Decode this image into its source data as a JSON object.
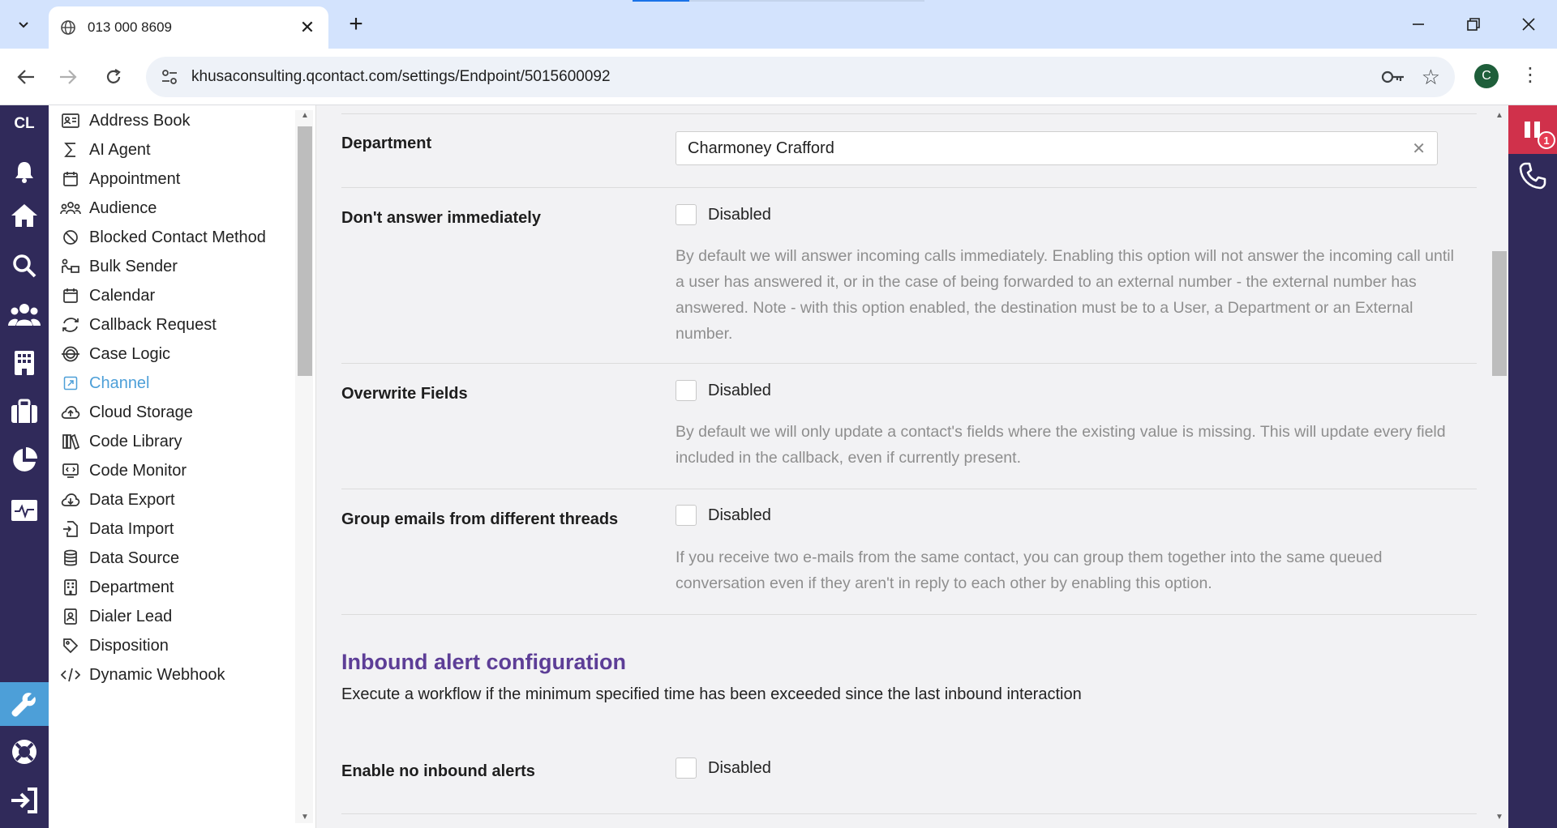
{
  "browser": {
    "tab_title": "013 000 8609",
    "url": "khusaconsulting.qcontact.com/settings/Endpoint/5015600092",
    "profile_initial": "C"
  },
  "rail": {
    "logo": "CL",
    "icons": [
      "bell-icon",
      "home-icon",
      "search-icon",
      "users-icon",
      "building-icon",
      "briefcase-icon",
      "pie-chart-icon",
      "monitor-icon",
      "wrench-icon",
      "lifebuoy-icon",
      "logout-icon"
    ]
  },
  "menu": {
    "items": [
      {
        "label": "Address Book",
        "icon": "address-book-icon"
      },
      {
        "label": "AI Agent",
        "icon": "sigma-icon"
      },
      {
        "label": "Appointment",
        "icon": "calendar-icon"
      },
      {
        "label": "Audience",
        "icon": "audience-icon"
      },
      {
        "label": "Blocked Contact Method",
        "icon": "blocked-icon"
      },
      {
        "label": "Bulk Sender",
        "icon": "bulk-sender-icon"
      },
      {
        "label": "Calendar",
        "icon": "calendar-icon"
      },
      {
        "label": "Callback Request",
        "icon": "callback-icon"
      },
      {
        "label": "Case Logic",
        "icon": "case-logic-icon"
      },
      {
        "label": "Channel",
        "icon": "channel-icon",
        "active": true
      },
      {
        "label": "Cloud Storage",
        "icon": "cloud-upload-icon"
      },
      {
        "label": "Code Library",
        "icon": "library-icon"
      },
      {
        "label": "Code Monitor",
        "icon": "code-monitor-icon"
      },
      {
        "label": "Data Export",
        "icon": "cloud-download-icon"
      },
      {
        "label": "Data Import",
        "icon": "file-import-icon"
      },
      {
        "label": "Data Source",
        "icon": "database-icon"
      },
      {
        "label": "Department",
        "icon": "department-icon"
      },
      {
        "label": "Dialer Lead",
        "icon": "contact-card-icon"
      },
      {
        "label": "Disposition",
        "icon": "tag-icon"
      },
      {
        "label": "Dynamic Webhook",
        "icon": "code-icon"
      }
    ]
  },
  "form": {
    "department": {
      "label": "Department",
      "value": "Charmoney Crafford"
    },
    "dont_answer": {
      "label": "Don't answer immediately",
      "state": "Disabled",
      "help": "By default we will answer incoming calls immediately. Enabling this option will not answer the incoming call until a user has answered it, or in the case of being forwarded to an external number - the external number has answered. Note - with this option enabled, the destination must be to a User, a Department or an External number."
    },
    "overwrite_fields": {
      "label": "Overwrite Fields",
      "state": "Disabled",
      "help": "By default we will only update a contact's fields where the existing value is missing. This will update every field included in the callback, even if currently present."
    },
    "group_emails": {
      "label": "Group emails from different threads",
      "state": "Disabled",
      "help": "If you receive two e-mails from the same contact, you can group them together into the same queued conversation even if they aren't in reply to each other by enabling this option."
    },
    "inbound_alert": {
      "title": "Inbound alert configuration",
      "description": "Execute a workflow if the minimum specified time has been exceeded since the last inbound interaction",
      "enable_label": "Enable no inbound alerts",
      "enable_state": "Disabled"
    }
  },
  "phone": {
    "badge_count": "1"
  },
  "colors": {
    "rail_bg": "#302a5a",
    "accent_blue": "#4d9fd8",
    "section_title": "#5d3e97",
    "pause_red": "#d0314b"
  }
}
